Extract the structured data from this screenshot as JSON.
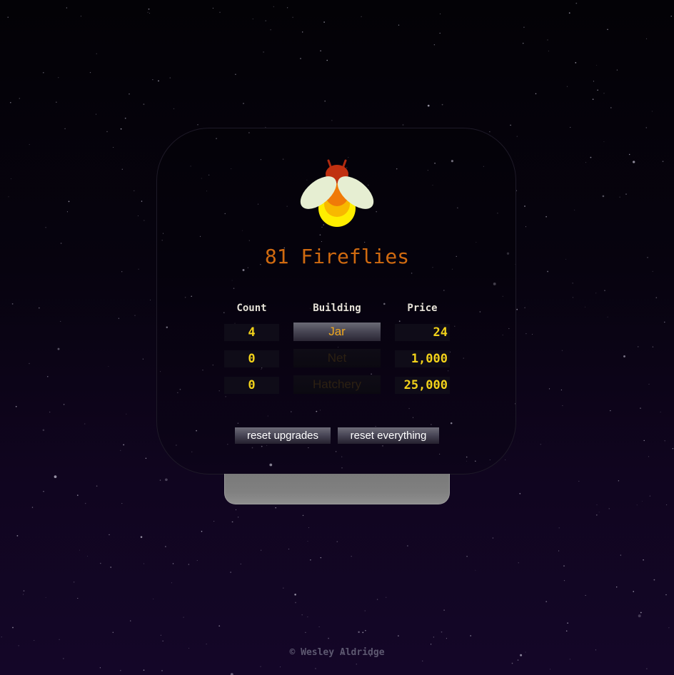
{
  "counter": {
    "value": "81",
    "unit": "Fireflies"
  },
  "table": {
    "headers": {
      "count": "Count",
      "building": "Building",
      "price": "Price"
    },
    "rows": [
      {
        "count": "4",
        "building": "Jar",
        "price": "24",
        "enabled": true
      },
      {
        "count": "0",
        "building": "Net",
        "price": "1,000",
        "enabled": false
      },
      {
        "count": "0",
        "building": "Hatchery",
        "price": "25,000",
        "enabled": false
      }
    ]
  },
  "buttons": {
    "reset_upgrades": "reset upgrades",
    "reset_everything": "reset everything"
  },
  "footer": "© Wesley Aldridge",
  "colors": {
    "counter_text": "#d06a10",
    "values": "#f2d21a",
    "building_enabled": "#f0a820",
    "firefly_glow": "#ffee00",
    "firefly_head": "#c03010"
  },
  "icons": {
    "firefly": "firefly-icon"
  }
}
